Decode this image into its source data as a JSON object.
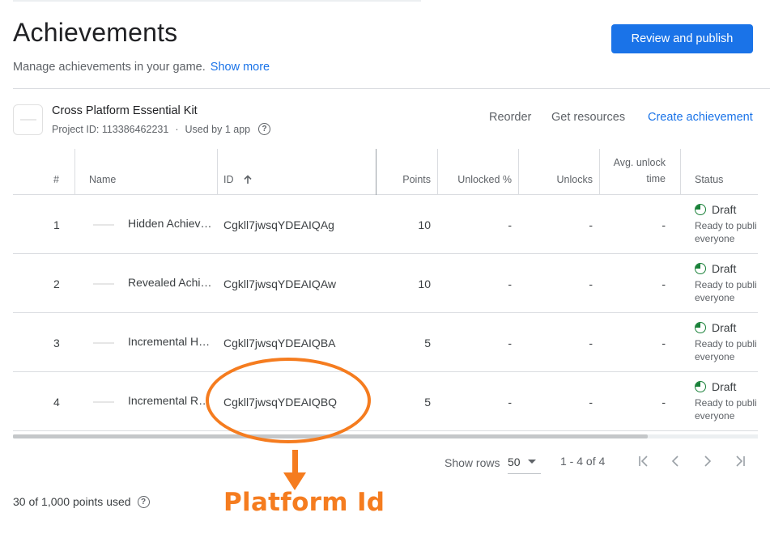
{
  "header": {
    "title": "Achievements",
    "subtitle": "Manage achievements in your game.",
    "show_more": "Show more",
    "publish_button": "Review and publish"
  },
  "project": {
    "name": "Cross Platform Essential Kit",
    "id_label": "Project ID: 113386462231",
    "separator": "·",
    "used_by": "Used by 1 app",
    "help_icon": "help-circle-icon"
  },
  "toolbar": {
    "reorder": "Reorder",
    "get_resources": "Get resources",
    "create": "Create achievement"
  },
  "table": {
    "columns": {
      "num": "#",
      "name": "Name",
      "id": "ID",
      "id_sort_icon": "arrow-up-icon",
      "points": "Points",
      "unlocked_pct": "Unlocked %",
      "unlocks": "Unlocks",
      "avg_unlock_time_line1": "Avg. unlock",
      "avg_unlock_time_line2": "time",
      "status": "Status"
    },
    "rows": [
      {
        "num": "1",
        "name": "Hidden Achiev…",
        "id": "Cgkll7jwsqYDEAIQAg",
        "points": "10",
        "unlocked_pct": "-",
        "unlocks": "-",
        "avg_time": "-",
        "status": "Draft",
        "status_desc_1": "Ready to publi",
        "status_desc_2": "everyone"
      },
      {
        "num": "2",
        "name": "Revealed Achi…",
        "id": "Cgkll7jwsqYDEAIQAw",
        "points": "10",
        "unlocked_pct": "-",
        "unlocks": "-",
        "avg_time": "-",
        "status": "Draft",
        "status_desc_1": "Ready to publi",
        "status_desc_2": "everyone"
      },
      {
        "num": "3",
        "name": "Incremental H…",
        "id": "Cgkll7jwsqYDEAIQBA",
        "points": "5",
        "unlocked_pct": "-",
        "unlocks": "-",
        "avg_time": "-",
        "status": "Draft",
        "status_desc_1": "Ready to publi",
        "status_desc_2": "everyone"
      },
      {
        "num": "4",
        "name": "Incremental R…",
        "id": "Cgkll7jwsqYDEAIQBQ",
        "points": "5",
        "unlocked_pct": "-",
        "unlocks": "-",
        "avg_time": "-",
        "status": "Draft",
        "status_desc_1": "Ready to publi",
        "status_desc_2": "everyone"
      }
    ]
  },
  "pagination": {
    "show_rows_label": "Show rows",
    "rows_value": "50",
    "range": "1 - 4 of 4"
  },
  "footer": {
    "points_used": "30 of 1,000 points used"
  },
  "annotation": {
    "label": "Platform Id",
    "color": "#f57c1f"
  },
  "colors": {
    "accent": "#1a73e8",
    "draft_green": "#188038"
  }
}
